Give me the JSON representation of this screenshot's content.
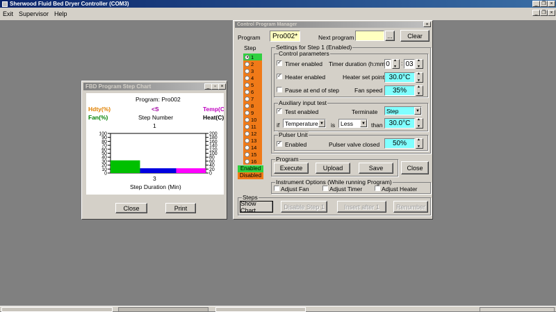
{
  "main_window": {
    "title": "Sherwood Fluid Bed Dryer Controller (COM3)",
    "menu": [
      "Exit",
      "Supervisor",
      "Help"
    ]
  },
  "cpm": {
    "title": "Control Program Manager",
    "program_label": "Program",
    "program_value": "Pro002*",
    "next_program_label": "Next program",
    "next_program_value": "",
    "browse_label": "...",
    "clear_label": "Clear",
    "step_header": "Step",
    "steps": [
      "1",
      "2",
      "3",
      "4",
      "5",
      "6",
      "7",
      "8",
      "9",
      "10",
      "11",
      "12",
      "13",
      "14",
      "15",
      "16"
    ],
    "selected_step": "1",
    "legend_enabled": "Enabled",
    "legend_disabled": "Disabled",
    "settings_title": "Settings for Step 1 (Enabled)",
    "control_params": {
      "title": "Control parameters",
      "timer_enabled": "Timer enabled",
      "timer_duration_label": "Timer duration (h:mm)",
      "timer_h": "0",
      "timer_sep": ":",
      "timer_mm": "03",
      "heater_enabled": "Heater enabled",
      "heater_setpoint_label": "Heater set point",
      "heater_setpoint": "30.0°C",
      "pause_label": "Pause at end of step",
      "fan_speed_label": "Fan speed",
      "fan_speed": "35%"
    },
    "aux": {
      "title": "Auxiliary input test",
      "test_enabled": "Test enabled",
      "terminate_label": "Terminate",
      "terminate_value": "Step",
      "if_label": "if",
      "param_value": "Temperature",
      "is_label": "is",
      "cmp_value": "Less",
      "than_label": "than",
      "than_value": "30.0°C"
    },
    "pulser": {
      "title": "Pulser Unit",
      "enabled": "Enabled",
      "valve_label": "Pulser valve closed",
      "valve_value": "50%"
    },
    "program_group": {
      "title": "Program",
      "execute": "Execute",
      "upload": "Upload",
      "save": "Save"
    },
    "close_label": "Close",
    "instrument": {
      "title": "Instrument Options (While running Program)",
      "adjust_fan": "Adjust Fan",
      "adjust_timer": "Adjust Timer",
      "adjust_heater": "Adjust Heater"
    },
    "steps_group": {
      "title": "Steps",
      "show_chart": "Show Chart",
      "disable_step": "Disable Step 1",
      "insert_after": "Insert after 1",
      "renumber": "Renumber"
    }
  },
  "chart_window": {
    "title": "FBD Program Step Chart",
    "program_label": "Program: Pro002",
    "hdty": "Hdty(%)",
    "s_label": "<S",
    "temp": "Temp(C",
    "fan": "Fan(%)",
    "step_number_label": "Step Number",
    "heat": "Heat(C)",
    "top_step": "1",
    "bottom_step": "3",
    "xlabel": "Step Duration (Min)",
    "close_label": "Close",
    "print_label": "Print"
  },
  "chart_data": {
    "type": "bar",
    "left_axis": {
      "label": "Fan(%)",
      "ticks": [
        "100",
        "90",
        "80",
        "70",
        "60",
        "50",
        "40",
        "30",
        "20",
        "10",
        "0"
      ],
      "ylim": [
        0,
        100
      ]
    },
    "right_axis": {
      "label": "Heat(C)",
      "ticks": [
        "200",
        "180",
        "160",
        "140",
        "120",
        "100",
        "80",
        "60",
        "40",
        "20",
        "0"
      ],
      "ylim": [
        0,
        200
      ]
    },
    "series": [
      {
        "color": "#00c000",
        "start": 0.0,
        "end": 0.31,
        "value": 32
      },
      {
        "color": "#0000e0",
        "start": 0.31,
        "end": 0.69,
        "value": 12
      },
      {
        "color": "#ff00ff",
        "start": 0.69,
        "end": 1.0,
        "value": 12
      }
    ]
  },
  "colors": {
    "step_orange": "#f07a18",
    "step_green": "#30d040",
    "field_yellow": "#ffffc0",
    "field_cyan": "#80ffff"
  }
}
